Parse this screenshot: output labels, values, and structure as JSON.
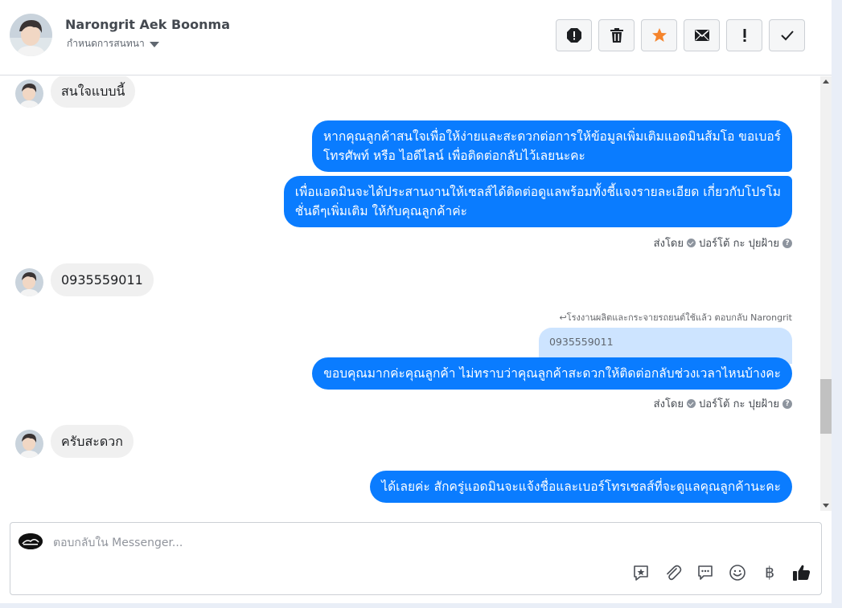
{
  "header": {
    "name": "Narongrit Aek Boonma",
    "subtitle": "กำหนดการสนทนา",
    "actions": [
      {
        "icon": "alert-circle-icon",
        "name": "spam-button"
      },
      {
        "icon": "trash-icon",
        "name": "delete-button"
      },
      {
        "icon": "star-icon",
        "name": "star-button"
      },
      {
        "icon": "envelope-icon",
        "name": "mark-unread-button"
      },
      {
        "icon": "exclamation-icon",
        "name": "follow-up-button"
      },
      {
        "icon": "check-icon",
        "name": "mark-done-button"
      }
    ]
  },
  "messages": {
    "m1": "สนใจแบบนี้",
    "m2_line1": "หากคุณลูกค้าสนใจเพื่อให้ง่ายและสะดวกต่อการให้ข้อมูลเพิ่มเติมแอดมินส้มโอ ขอเบอร์",
    "m2_line2": "โทรศัพท์ หรือ ไอดีไลน์ เพื่อติดต่อกลับไว้เลยนะคะ",
    "m3_line1": "เพื่อแอดมินจะได้ประสานงานให้เซลส์ได้ติดต่อดูแลพร้อมทั้งชี้แจงรายละเอียด เกี่ยวกับโปรโม",
    "m3_line2": "ชั่นดีๆเพิ่มเติม ให้กับคุณลูกค้าค่ะ",
    "sent_by_1": "ส่งโดย",
    "sender_1": "ปอร์โต้ กะ ปุยฝ้าย",
    "m4": "0935559011",
    "reply_note": "โรงงานผลิตและกระจายรถยนต์ใช้แล้ว ตอบกลับ Narongrit",
    "quoted": "0935559011",
    "m5": "ขอบคุณมากค่ะคุณลูกค้า ไม่ทราบว่าคุณลูกค้าสะดวกให้ติดต่อกลับช่วงเวลาไหนบ้างคะ",
    "sent_by_2": "ส่งโดย",
    "sender_2": "ปอร์โต้ กะ ปุยฝ้าย",
    "m6": "ครับสะดวก",
    "m7": "ได้เลยค่ะ สักครู่แอดมินจะแจ้งชื่อและเบอร์โทรเซลส์ที่จะดูแลคุณลูกค้านะคะ"
  },
  "composer": {
    "placeholder": "ตอบกลับใน Messenger...",
    "baht_symbol": "฿",
    "tools": [
      "saved-reply-icon",
      "paperclip-icon",
      "chat-bubble-icon",
      "emoji-icon",
      "baht-icon",
      "thumbs-up-icon"
    ]
  },
  "colors": {
    "outgoing": "#0a7cff",
    "incoming": "#f0f0f0",
    "star": "#f5842c"
  }
}
